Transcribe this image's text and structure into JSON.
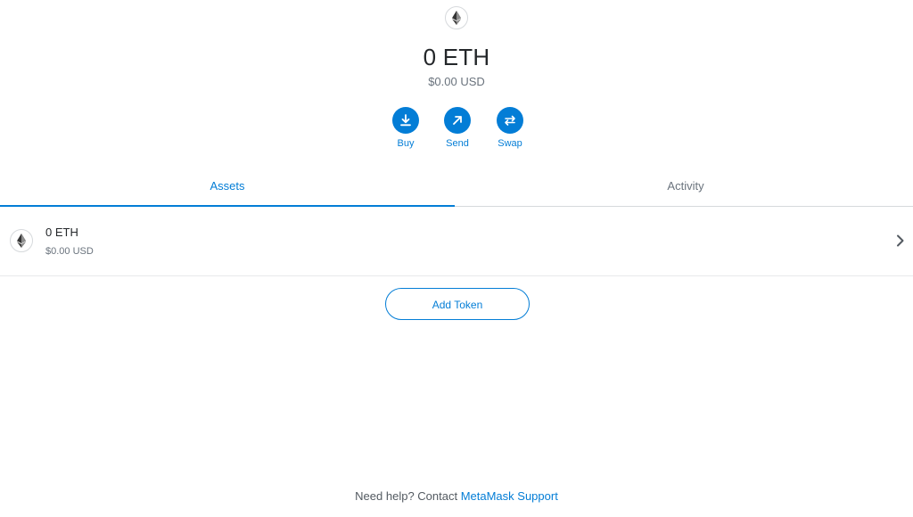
{
  "overview": {
    "token_icon": "ethereum-icon",
    "balance": "0 ETH",
    "fiat_balance": "$0.00 USD"
  },
  "actions": [
    {
      "label": "Buy",
      "icon": "download-icon"
    },
    {
      "label": "Send",
      "icon": "arrow-up-right-icon"
    },
    {
      "label": "Swap",
      "icon": "swap-icon"
    }
  ],
  "tabs": [
    {
      "label": "Assets",
      "active": true
    },
    {
      "label": "Activity",
      "active": false
    }
  ],
  "assets": [
    {
      "icon": "ethereum-icon",
      "amount": "0 ETH",
      "fiat": "$0.00 USD"
    }
  ],
  "add_token_label": "Add Token",
  "help": {
    "prefix": "Need help? Contact ",
    "link": "MetaMask Support"
  },
  "colors": {
    "accent": "#037dd6",
    "text_primary": "#24272a",
    "text_secondary": "#6a737d",
    "border": "#d6d9dc"
  }
}
